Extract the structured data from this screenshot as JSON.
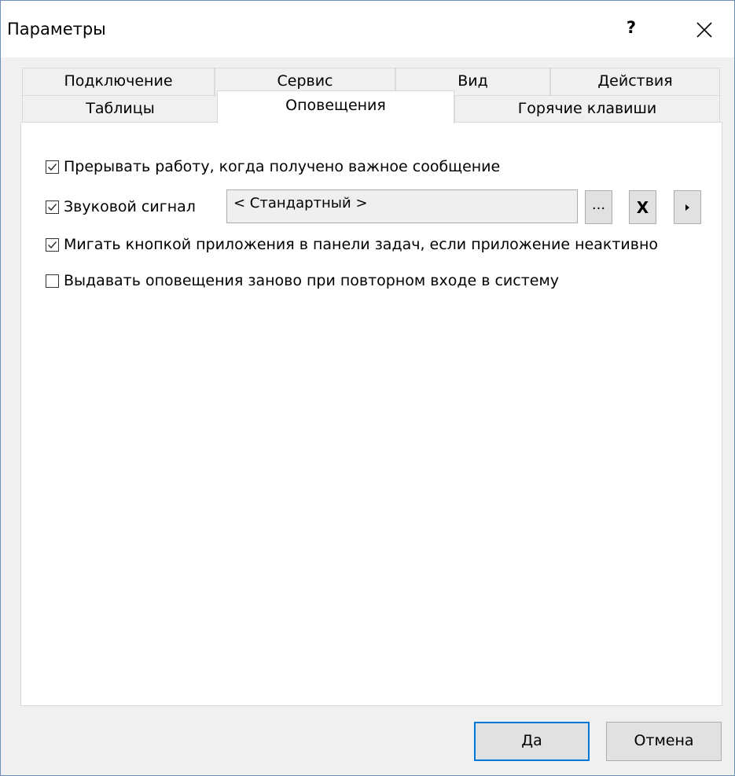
{
  "window": {
    "title": "Параметры",
    "help_label": "?"
  },
  "tabs": {
    "row_top": [
      "Подключение",
      "Сервис",
      "Вид",
      "Действия"
    ],
    "row_bottom": [
      "Таблицы",
      "Оповещения",
      "Горячие клавиши"
    ],
    "active": "Оповещения"
  },
  "options": [
    {
      "label": "Прерывать работу, когда получено важное сообщение",
      "checked": true
    },
    {
      "label": "Звуковой сигнал",
      "checked": true
    },
    {
      "label": "Мигать кнопкой приложения в панели задач, если приложение неактивно",
      "checked": true
    },
    {
      "label": "Выдавать оповещения заново при повторном входе в систему",
      "checked": false
    }
  ],
  "sound": {
    "value": "< Стандартный >",
    "browse_label": "...",
    "clear_label": "X",
    "play_icon": "play-icon"
  },
  "footer": {
    "ok_label": "Да",
    "cancel_label": "Отмена"
  },
  "colors": {
    "default_button_border": "#0078d7",
    "checkmark": "#333333"
  }
}
